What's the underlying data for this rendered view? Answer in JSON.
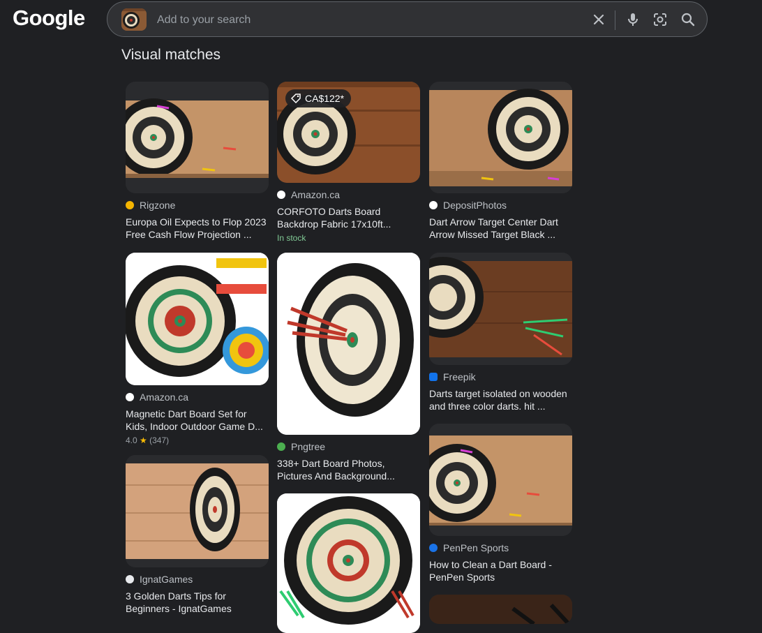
{
  "header": {
    "logo_text": "Google",
    "search": {
      "placeholder": "Add to your search",
      "icons": [
        "image-thumbnail",
        "close-icon",
        "mic-icon",
        "lens-icon",
        "search-icon"
      ]
    }
  },
  "section_title": "Visual matches",
  "colors": {
    "background": "#1f2023",
    "searchbar": "#303134",
    "text": "#e8eaed",
    "secondary_text": "#bdc1c6",
    "in_stock": "#81c995"
  },
  "results": [
    {
      "source": "Rigzone",
      "title_line1": "Europa Oil Expects to Flop 2023",
      "title_line2": "Free Cash Flow Projection ..."
    },
    {
      "price": "CA$122*",
      "source": "Amazon.ca",
      "title_line1": "CORFOTO Darts Board",
      "title_line2": "Backdrop Fabric 17x10ft...",
      "status": "In stock"
    },
    {
      "source": "DepositPhotos",
      "title_line1": "Dart Arrow Target Center Dart",
      "title_line2": "Arrow Missed Target Black ..."
    },
    {
      "source": "Amazon.ca",
      "title_line1": "Magnetic Dart Board Set for",
      "title_line2": "Kids, Indoor Outdoor Game D...",
      "rating": "4.0",
      "reviews": "(347)"
    },
    {
      "source": "Pngtree",
      "title_line1": "338+ Dart Board Photos,",
      "title_line2": "Pictures And Background..."
    },
    {
      "source": "Freepik",
      "title_line1": "Darts target isolated on wooden",
      "title_line2": "and three color darts. hit ..."
    },
    {
      "source": "IgnatGames",
      "title_line1": "3 Golden Darts Tips for",
      "title_line2": "Beginners - IgnatGames"
    },
    {
      "source": "PenPen Sports",
      "title_line1": "How to Clean a Dart Board -",
      "title_line2": "PenPen Sports"
    }
  ]
}
